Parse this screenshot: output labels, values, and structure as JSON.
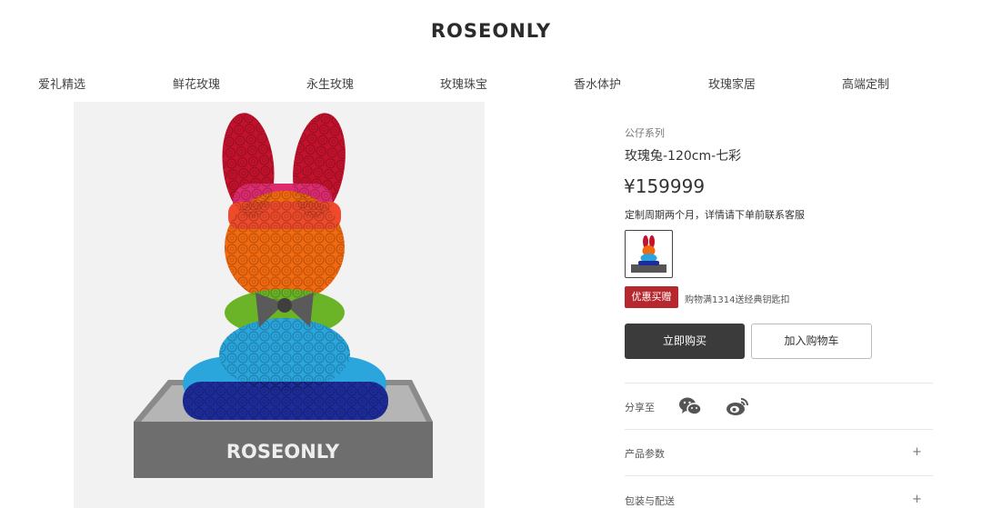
{
  "brand": "ROSEONLY",
  "nav": [
    "爱礼精选",
    "鲜花玫瑰",
    "永生玫瑰",
    "玫瑰珠宝",
    "香水体护",
    "玫瑰家居",
    "高端定制"
  ],
  "gallery": {
    "base_text": "ROSEONLY"
  },
  "product": {
    "series": "公仔系列",
    "title": "玫瑰兔-120cm-七彩",
    "price": "¥159999",
    "note": "定制周期两个月，详情请下单前联系客服"
  },
  "promo": {
    "tag": "优惠买赠",
    "text": "购物满1314送经典钥匙扣"
  },
  "actions": {
    "buy": "立即购买",
    "cart": "加入购物车"
  },
  "share": {
    "label": "分享至",
    "icons": [
      "wechat-icon",
      "weibo-icon"
    ]
  },
  "sections": [
    {
      "label": "产品参数",
      "toggle": "+"
    },
    {
      "label": "包装与配送",
      "toggle": "+"
    }
  ],
  "colors": {
    "promo": "#b7282e",
    "buy_button": "#3b3b3b"
  }
}
